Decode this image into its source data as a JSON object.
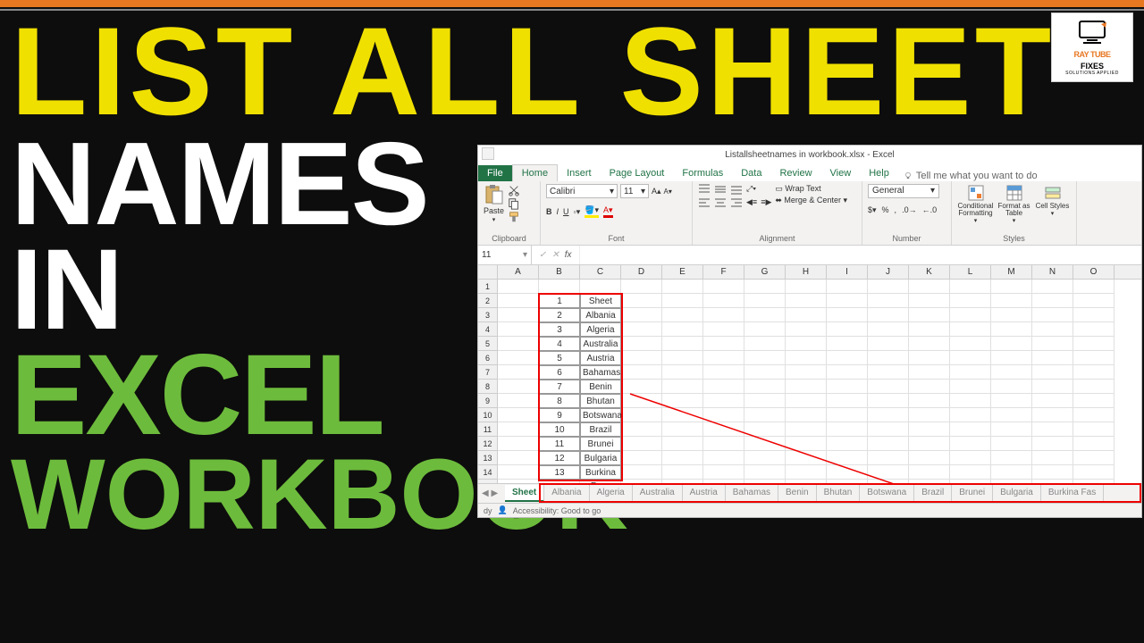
{
  "title": {
    "line1": "LIST ALL SHEET",
    "line2": "NAMES",
    "line3": "IN",
    "line4": "EXCEL",
    "line5": "WORKBOOK"
  },
  "logo": {
    "line1": "RAY TUBE",
    "line2": "FIXES",
    "line3": "SOLUTIONS APPLIED"
  },
  "excel": {
    "windowTitle": "Listallsheetnames in workbook.xlsx - Excel",
    "menuTabs": {
      "file": "File",
      "home": "Home",
      "insert": "Insert",
      "pageLayout": "Page Layout",
      "formulas": "Formulas",
      "data": "Data",
      "review": "Review",
      "view": "View",
      "help": "Help",
      "tellMe": "Tell me what you want to do"
    },
    "ribbon": {
      "clipboard": {
        "label": "Clipboard",
        "paste": "Paste"
      },
      "font": {
        "label": "Font",
        "name": "Calibri",
        "size": "11",
        "bold": "B",
        "italic": "I",
        "underline": "U"
      },
      "alignment": {
        "label": "Alignment",
        "wrap": "Wrap Text",
        "merge": "Merge & Center"
      },
      "number": {
        "label": "Number",
        "format": "General"
      },
      "styles": {
        "label": "Styles",
        "cond": "Conditional Formatting",
        "table": "Format as Table",
        "cell": "Cell Styles"
      }
    },
    "nameBox": "11",
    "fx": "fx",
    "columns": [
      "A",
      "B",
      "C",
      "D",
      "E",
      "F",
      "G",
      "H",
      "I",
      "J",
      "K",
      "L",
      "M",
      "N",
      "O"
    ],
    "dataRows": [
      {
        "n": "1",
        "v": "Sheet"
      },
      {
        "n": "2",
        "v": "Albania"
      },
      {
        "n": "3",
        "v": "Algeria"
      },
      {
        "n": "4",
        "v": "Australia"
      },
      {
        "n": "5",
        "v": "Austria"
      },
      {
        "n": "6",
        "v": "Bahamas"
      },
      {
        "n": "7",
        "v": "Benin"
      },
      {
        "n": "8",
        "v": "Bhutan"
      },
      {
        "n": "9",
        "v": "Botswana"
      },
      {
        "n": "10",
        "v": "Brazil"
      },
      {
        "n": "11",
        "v": "Brunei"
      },
      {
        "n": "12",
        "v": "Bulgaria"
      },
      {
        "n": "13",
        "v": "Burkina Faso"
      }
    ],
    "sheetTabs": [
      "Sheet",
      "Albania",
      "Algeria",
      "Australia",
      "Austria",
      "Bahamas",
      "Benin",
      "Bhutan",
      "Botswana",
      "Brazil",
      "Brunei",
      "Bulgaria",
      "Burkina Fas"
    ],
    "status": {
      "ready": "dy",
      "access": "Accessibility: Good to go"
    }
  }
}
